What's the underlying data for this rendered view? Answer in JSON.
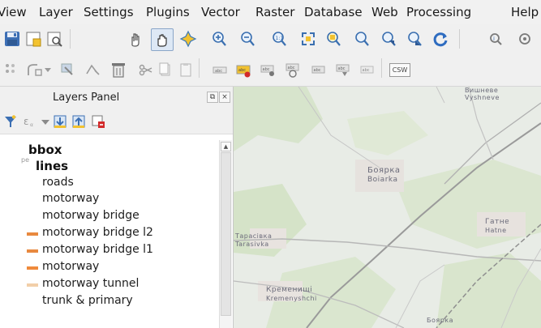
{
  "menu": {
    "items": [
      "iew",
      "Layer",
      "Settings",
      "Plugins",
      "Vector",
      "Raster",
      "Database",
      "Web",
      "Processing",
      "Help"
    ],
    "prefix": "V"
  },
  "toolbar1": {
    "icons": [
      "save-project-icon",
      "new-print-layout-icon",
      "layout-manager-icon",
      "touch-pan-icon",
      "pan-map-icon",
      "pan-to-selection-icon",
      "zoom-in-icon",
      "zoom-out-icon",
      "zoom-native-icon",
      "zoom-full-icon",
      "zoom-to-selection-icon",
      "zoom-to-layer-icon",
      "zoom-last-icon",
      "zoom-next-icon",
      "refresh-icon",
      "identify-icon",
      "measure-icon"
    ]
  },
  "toolbar2": {
    "icons": [
      "digitize-point-icon",
      "add-feature-icon",
      "vertex-tool-icon",
      "move-feature-icon",
      "delete-icon",
      "cut-icon",
      "copy-icon",
      "paste-icon",
      "label-icon",
      "label-pin-icon",
      "label-move-icon",
      "label-rotate-icon",
      "label-change-icon",
      "label-show-icon",
      "label-extra-icon",
      "csw-icon"
    ],
    "csw_label": "CSW"
  },
  "layers_panel": {
    "title": "Layers Panel",
    "float_button": "⧉",
    "close_button": "×",
    "tools": [
      "filter-icon",
      "filter-legend-icon",
      "expand-all-icon",
      "collapse-all-icon",
      "remove-layer-icon"
    ],
    "layers": [
      {
        "label": "bbox",
        "bold": true,
        "indent": 35,
        "swatch": null
      },
      {
        "label": "lines",
        "bold": true,
        "indent": 44,
        "swatch": null
      },
      {
        "label": "roads",
        "bold": false,
        "indent": 52,
        "swatch": null
      },
      {
        "label": "motorway",
        "bold": false,
        "indent": 52,
        "swatch": null
      },
      {
        "label": "motorway bridge",
        "bold": false,
        "indent": 52,
        "swatch": null
      },
      {
        "label": "motorway bridge l2",
        "bold": false,
        "indent": 52,
        "swatch": "#e8893f"
      },
      {
        "label": "motorway bridge l1",
        "bold": false,
        "indent": 52,
        "swatch": "#e8893f"
      },
      {
        "label": "motorway",
        "bold": false,
        "indent": 52,
        "swatch": "#ef8a3c"
      },
      {
        "label": "motorway tunnel",
        "bold": false,
        "indent": 52,
        "swatch": "#f2cfa9"
      },
      {
        "label": "trunk & primary",
        "bold": false,
        "indent": 52,
        "swatch": null
      }
    ]
  },
  "map": {
    "labels": [
      "Боярка",
      "Boiarka",
      "Тарасівка",
      "Tarasivka",
      "Гатне",
      "Hatne",
      "Кременищі",
      "Kremenyshchi",
      "Вишневе",
      "Vyshneve",
      "Боярка"
    ]
  }
}
